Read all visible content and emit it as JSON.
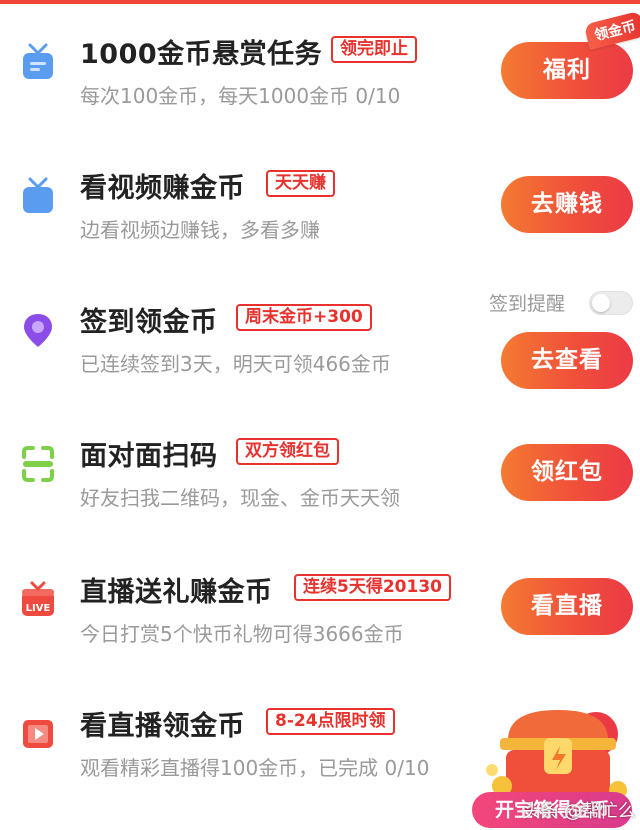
{
  "tasks": [
    {
      "title": "1000金币悬赏任务",
      "badge": "领完即止",
      "desc": "每次100金币，每天1000金币 0/10",
      "button": "福利",
      "ribbon": "领金币",
      "icon": "gift-tv-icon",
      "icon_color": "#5a9cf0"
    },
    {
      "title": "看视频赚金币",
      "badge": "天天赚",
      "desc": "边看视频边赚钱，多看多赚",
      "button": "去赚钱",
      "icon": "tv-icon",
      "icon_color": "#5a9cf0"
    },
    {
      "title": "签到领金币",
      "badge": "周末金币+300",
      "desc": "已连续签到3天，明天可领466金币",
      "button": "去查看",
      "icon": "location-pin-icon",
      "icon_color": "#8a4de8",
      "reminder_label": "签到提醒",
      "reminder_on": false
    },
    {
      "title": "面对面扫码",
      "badge": "双方领红包",
      "desc": "好友扫我二维码，现金、金币天天领",
      "button": "领红包",
      "icon": "scan-icon",
      "icon_color": "#7ed04a"
    },
    {
      "title": "直播送礼赚金币",
      "badge": "连续5天得20130",
      "desc": "今日打赏5个快币礼物可得3666金币",
      "button": "看直播",
      "icon": "live-gift-icon",
      "icon_color": "#ee4a3f"
    },
    {
      "title": "看直播领金币",
      "badge": "8-24点限时领",
      "desc": "观看精彩直播得100金币，已完成 0/10",
      "icon": "play-icon",
      "icon_color": "#ee4a3f"
    }
  ],
  "treasure": {
    "label": "开宝箱得金币"
  },
  "watermark": "头条 @帮忙么",
  "colors": {
    "accent": "#e8322e",
    "button_start": "#f47a32",
    "button_end": "#ec3a45"
  }
}
